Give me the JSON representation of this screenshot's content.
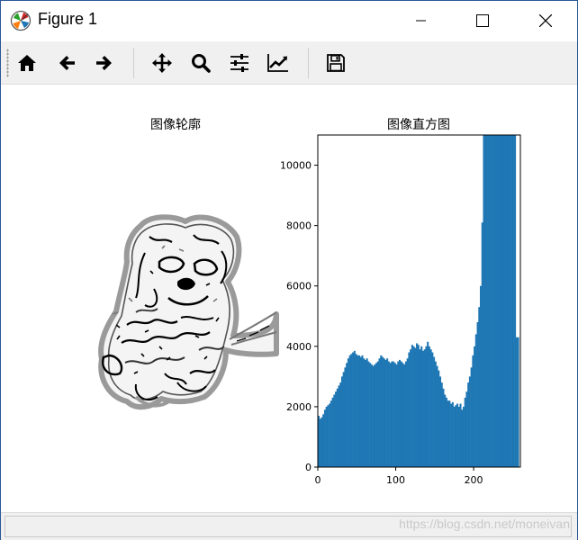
{
  "window": {
    "title": "Figure 1",
    "controls": {
      "minimize": "–",
      "maximize": "☐",
      "close": "✕"
    }
  },
  "toolbar": {
    "buttons": [
      {
        "name": "home",
        "icon": "home-icon"
      },
      {
        "name": "back",
        "icon": "arrow-left-icon"
      },
      {
        "name": "forward",
        "icon": "arrow-right-icon"
      },
      {
        "name": "pan",
        "icon": "move-icon"
      },
      {
        "name": "zoom",
        "icon": "magnifier-icon"
      },
      {
        "name": "configure-subplots",
        "icon": "sliders-icon"
      },
      {
        "name": "edit-axis",
        "icon": "line-chart-icon"
      },
      {
        "name": "save",
        "icon": "floppy-disk-icon"
      }
    ]
  },
  "subplots": {
    "left_title": "图像轮廓",
    "right_title": "图像直方图"
  },
  "statusbar": {
    "message": "",
    "watermark": "https://blog.csdn.net/moneivan"
  },
  "colors": {
    "bar": "#1f77b4",
    "window_border": "#2b5797",
    "toolbar_bg": "#f0f0f0"
  },
  "chart_data": {
    "type": "bar",
    "title": "图像直方图",
    "xlabel": "",
    "ylabel": "",
    "xlim": [
      0,
      260
    ],
    "ylim": [
      0,
      11000
    ],
    "xticks": [
      0,
      100,
      200
    ],
    "yticks": [
      0,
      2000,
      4000,
      6000,
      8000,
      10000
    ],
    "bin_width": 2,
    "series": [
      {
        "x": [
          0,
          2,
          4,
          6,
          8,
          10,
          12,
          14,
          16,
          18,
          20,
          22,
          24,
          26,
          28,
          30,
          32,
          34,
          36,
          38,
          40,
          42,
          44,
          46,
          48,
          50,
          52,
          54,
          56,
          58,
          60,
          62,
          64,
          66,
          68,
          70,
          72,
          74,
          76,
          78,
          80,
          82,
          84,
          86,
          88,
          90,
          92,
          94,
          96,
          98,
          100,
          102,
          104,
          106,
          108,
          110,
          112,
          114,
          116,
          118,
          120,
          122,
          124,
          126,
          128,
          130,
          132,
          134,
          136,
          138,
          140,
          142,
          144,
          146,
          148,
          150,
          152,
          154,
          156,
          158,
          160,
          162,
          164,
          166,
          168,
          170,
          172,
          174,
          176,
          178,
          180,
          182,
          184,
          186,
          188,
          190,
          192,
          194,
          196,
          198,
          200,
          202,
          204,
          206,
          208,
          210,
          212,
          214,
          216,
          218,
          220,
          222,
          224,
          226,
          228,
          230,
          232,
          234,
          236,
          238,
          240,
          242,
          244,
          246,
          248,
          250,
          252,
          254,
          256
        ],
        "values": [
          1700,
          1600,
          1650,
          1750,
          1900,
          2000,
          2050,
          2100,
          2200,
          2300,
          2400,
          2500,
          2600,
          2700,
          2800,
          3000,
          3150,
          3300,
          3450,
          3600,
          3700,
          3750,
          3800,
          3850,
          3750,
          3700,
          3700,
          3650,
          3700,
          3600,
          3550,
          3600,
          3500,
          3450,
          3400,
          3350,
          3400,
          3450,
          3500,
          3600,
          3700,
          3650,
          3600,
          3550,
          3600,
          3500,
          3450,
          3500,
          3500,
          3450,
          3400,
          3500,
          3550,
          3500,
          3450,
          3400,
          3500,
          3600,
          3800,
          3900,
          4050,
          4000,
          3950,
          4100,
          4050,
          3900,
          4000,
          3850,
          3900,
          4000,
          4150,
          4000,
          3900,
          3800,
          3650,
          3500,
          3350,
          3200,
          3000,
          2800,
          2600,
          2400,
          2300,
          2200,
          2200,
          2100,
          2150,
          2000,
          2050,
          2100,
          2000,
          2100,
          1900,
          2000,
          2300,
          2500,
          2800,
          3000,
          3300,
          3700,
          4000,
          4400,
          4800,
          5300,
          6000,
          8100,
          11000,
          11000,
          11000,
          11000,
          11000,
          11000,
          11000,
          11000,
          11000,
          11000,
          11000,
          11000,
          11000,
          11000,
          11000,
          11000,
          11000,
          11000,
          11000,
          11000,
          11000,
          4300,
          4300
        ]
      }
    ]
  }
}
